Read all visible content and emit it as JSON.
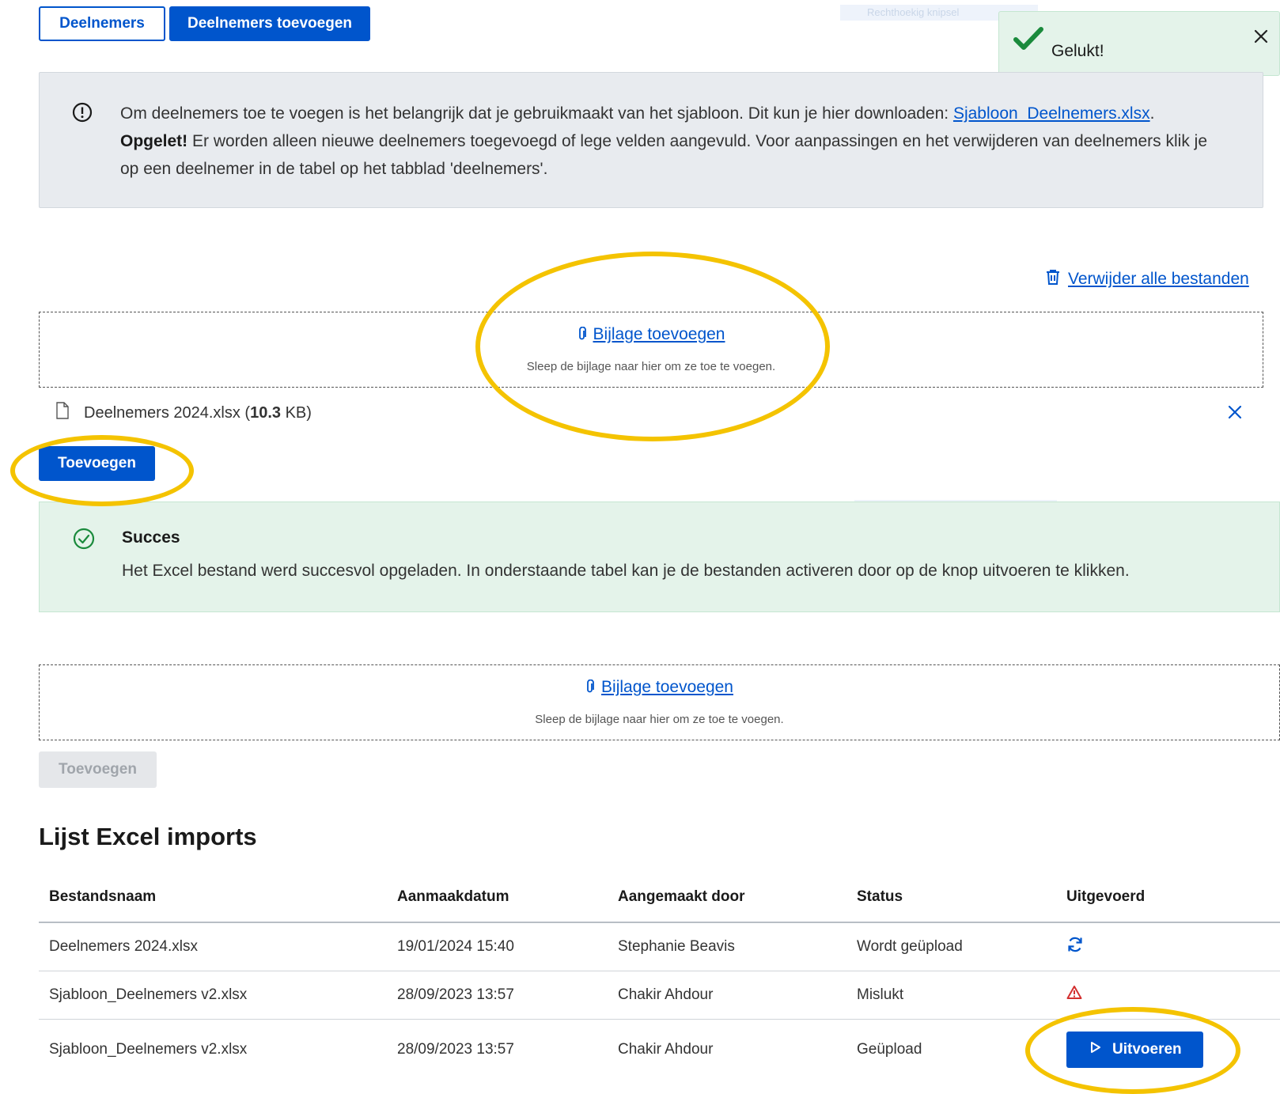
{
  "tabs": {
    "participants_label": "Deelnemers",
    "add_participants_label": "Deelnemers toevoegen"
  },
  "toast": {
    "message": "Gelukt!"
  },
  "snip_overlay": {
    "label": "Rechthoekig knipsel"
  },
  "info": {
    "line1_prefix": "Om deelnemers toe te voegen is het belangrijk dat je gebruikmaakt van het sjabloon. Dit kun je hier downloaden: ",
    "template_link": "Sjabloon_Deelnemers.xlsx",
    "line1_suffix": ".",
    "warning_label": "Opgelet!",
    "warning_text": " Er worden alleen nieuwe deelnemers toegevoegd of lege velden aangevuld. Voor aanpassingen en het verwijderen van deelnemers klik je op een deelnemer in de tabel op het tabblad 'deelnemers'."
  },
  "delete_all": {
    "label": "Verwijder alle bestanden"
  },
  "dropzone": {
    "link": "Bijlage toevoegen",
    "hint": "Sleep de bijlage naar hier om ze toe te voegen."
  },
  "uploaded_file": {
    "name": "Deelnemers 2024.xlsx",
    "size_open": " (",
    "size_value": "10.3",
    "size_unit": " KB)"
  },
  "add_button": {
    "label": "Toevoegen"
  },
  "success": {
    "title": "Succes",
    "body": "Het Excel bestand werd succesvol opgeladen. In onderstaande tabel kan je de bestanden activeren door op de knop uitvoeren te klikken."
  },
  "imports": {
    "title": "Lijst Excel imports",
    "columns": [
      "Bestandsnaam",
      "Aanmaakdatum",
      "Aangemaakt door",
      "Status",
      "Uitgevoerd"
    ],
    "rows": [
      {
        "file": "Deelnemers 2024.xlsx",
        "date": "19/01/2024 15:40",
        "by": "Stephanie Beavis",
        "status": "Wordt geüpload",
        "executed_icon": "sync-icon"
      },
      {
        "file": "Sjabloon_Deelnemers v2.xlsx",
        "date": "28/09/2023 13:57",
        "by": "Chakir Ahdour",
        "status": "Mislukt",
        "executed_icon": "warning-triangle-icon"
      },
      {
        "file": "Sjabloon_Deelnemers v2.xlsx",
        "date": "28/09/2023 13:57",
        "by": "Chakir Ahdour",
        "status": "Geüpload",
        "executed_label": "Uitvoeren"
      }
    ]
  },
  "colors": {
    "primary": "#0055cc",
    "info_background": "#e8ebef",
    "success_background": "#e4f3ea",
    "success_icon": "#1a8a3c",
    "error_icon": "#d32f2f",
    "annotation": "#f4c300"
  }
}
